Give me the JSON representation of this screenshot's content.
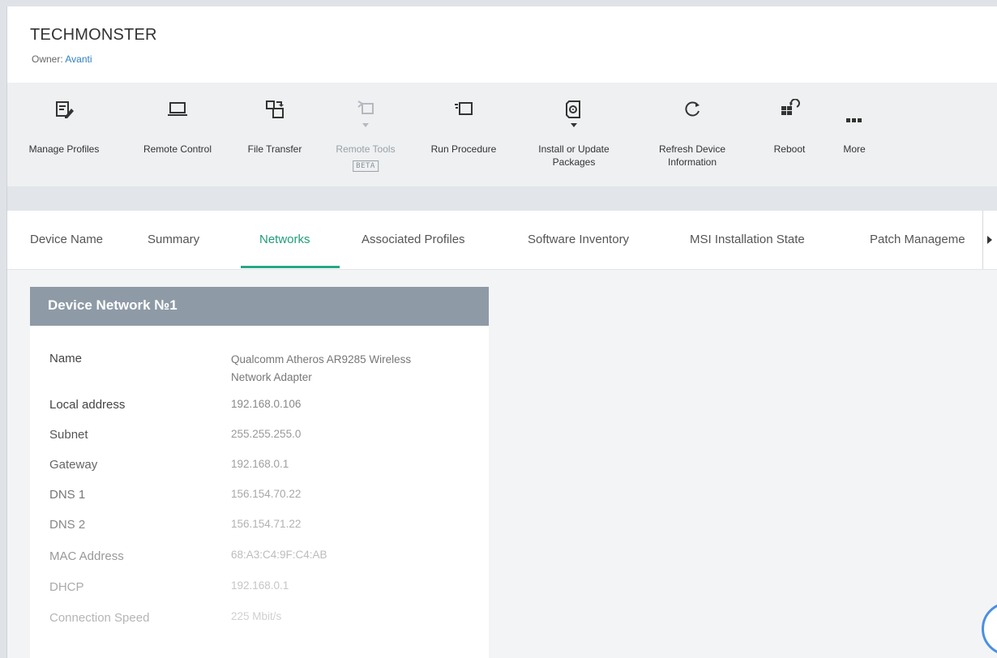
{
  "device": {
    "title": "TECHMONSTER",
    "owner_label": "Owner: ",
    "owner_name": "Avanti"
  },
  "toolbar": {
    "manage_profiles": "Manage Profiles",
    "remote_control": "Remote Control",
    "file_transfer": "File Transfer",
    "remote_tools": "Remote Tools",
    "remote_tools_badge": "BETA",
    "run_procedure": "Run Procedure",
    "install_update_line1": "Install or Update",
    "install_update_line2": "Packages",
    "refresh_line1": "Refresh Device",
    "refresh_line2": "Information",
    "reboot": "Reboot",
    "more": "More"
  },
  "tabs": {
    "device_name": "Device Name",
    "summary": "Summary",
    "networks": "Networks",
    "associated_profiles": "Associated Profiles",
    "software_inventory": "Software Inventory",
    "msi_installation_state": "MSI Installation State",
    "patch_management": "Patch Manageme",
    "active": "Networks"
  },
  "network_card": {
    "title": "Device Network №1",
    "rows": [
      {
        "label": "Name",
        "value_line1": "Qualcomm Atheros AR9285 Wireless",
        "value_line2": "Network Adapter"
      },
      {
        "label": "Local address",
        "value": "192.168.0.106"
      },
      {
        "label": "Subnet",
        "value": "255.255.255.0"
      },
      {
        "label": "Gateway",
        "value": "192.168.0.1"
      },
      {
        "label": "DNS 1",
        "value": "156.154.70.22"
      },
      {
        "label": "DNS 2",
        "value": "156.154.71.22"
      },
      {
        "label": "MAC Address",
        "value": "68:A3:C4:9F:C4:AB"
      },
      {
        "label": "DHCP",
        "value": "192.168.0.1"
      },
      {
        "label": "Connection Speed",
        "value": "225 Mbit/s"
      }
    ]
  },
  "colors": {
    "accent": "#27a884",
    "link": "#2f7fc1",
    "card_header": "#8e9aa6"
  },
  "icons": {
    "manage_profiles": "edit-profile-icon",
    "remote_control": "laptop-icon",
    "file_transfer": "file-transfer-icon",
    "remote_tools": "remote-tools-icon",
    "run_procedure": "run-procedure-icon",
    "install_update": "package-install-icon",
    "refresh": "refresh-icon",
    "reboot": "reboot-icon",
    "more": "ellipsis-icon",
    "help": "help-icon"
  }
}
